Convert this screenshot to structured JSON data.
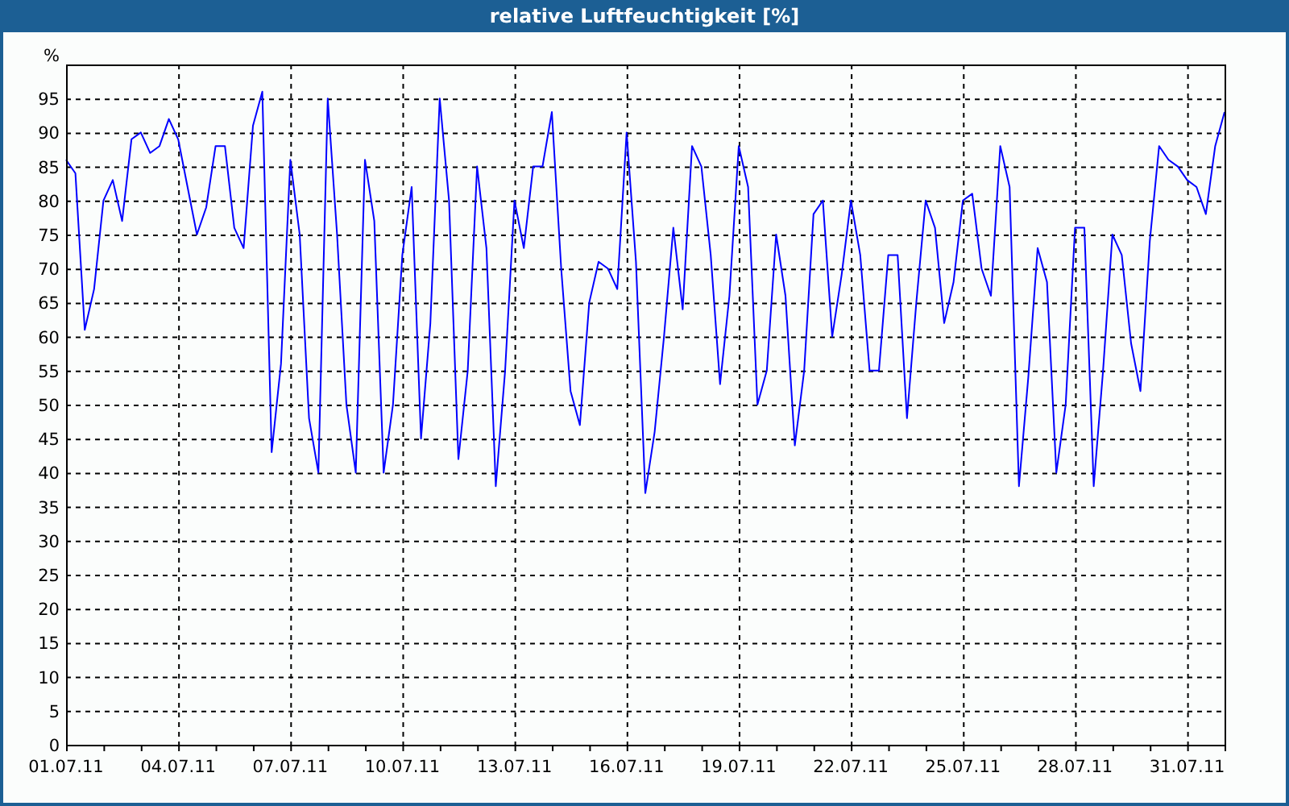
{
  "chart": {
    "chart_data": {
      "type": "line",
      "title": "relative Luftfeuchtigkeit [%]",
      "ylabel": "%",
      "grid": true,
      "ylim": [
        0,
        100
      ],
      "yticks": [
        0,
        5,
        10,
        15,
        20,
        25,
        30,
        35,
        40,
        45,
        50,
        55,
        60,
        65,
        70,
        75,
        80,
        85,
        90,
        95
      ],
      "categories": [
        "01.07.11",
        null,
        null,
        null,
        null,
        null,
        null,
        null,
        null,
        null,
        null,
        null,
        "04.07.11",
        null,
        null,
        null,
        null,
        null,
        null,
        null,
        null,
        null,
        null,
        null,
        "07.07.11",
        null,
        null,
        null,
        null,
        null,
        null,
        null,
        null,
        null,
        null,
        null,
        "10.07.11",
        null,
        null,
        null,
        null,
        null,
        null,
        null,
        null,
        null,
        null,
        null,
        "13.07.11",
        null,
        null,
        null,
        null,
        null,
        null,
        null,
        null,
        null,
        null,
        null,
        "16.07.11",
        null,
        null,
        null,
        null,
        null,
        null,
        null,
        null,
        null,
        null,
        null,
        "19.07.11",
        null,
        null,
        null,
        null,
        null,
        null,
        null,
        null,
        null,
        null,
        null,
        "22.07.11",
        null,
        null,
        null,
        null,
        null,
        null,
        null,
        null,
        null,
        null,
        null,
        "25.07.11",
        null,
        null,
        null,
        null,
        null,
        null,
        null,
        null,
        null,
        null,
        null,
        "28.07.11",
        null,
        null,
        null,
        null,
        null,
        null,
        null,
        null,
        null,
        null,
        null,
        "31.07.11",
        null,
        null,
        null,
        null
      ],
      "series": [
        {
          "color": "#0000ff",
          "values": [
            86,
            84,
            61,
            67,
            80,
            83,
            77,
            89,
            90,
            87,
            88,
            92,
            89,
            82,
            75,
            79,
            88,
            88,
            76,
            73,
            91,
            96,
            43,
            56,
            86,
            75,
            48,
            40,
            95,
            75,
            50,
            40,
            86,
            77,
            40,
            50,
            72,
            82,
            45,
            62,
            95,
            80,
            42,
            55,
            85,
            73,
            38,
            55,
            80,
            73,
            85,
            85,
            93,
            70,
            52,
            47,
            65,
            71,
            70,
            67,
            90,
            71,
            37,
            46,
            60,
            76,
            64,
            88,
            85,
            72,
            53,
            66,
            88,
            82,
            50,
            55,
            75,
            66,
            44,
            55,
            78,
            80,
            60,
            69,
            80,
            72,
            55,
            55,
            72,
            72,
            48,
            65,
            80,
            76,
            62,
            68,
            80,
            81,
            70,
            66,
            88,
            82,
            38,
            54,
            73,
            68,
            40,
            50,
            76,
            76,
            38,
            55,
            75,
            72,
            59,
            52,
            74,
            88,
            86,
            85,
            83,
            82,
            78,
            88,
            93
          ]
        }
      ]
    }
  }
}
